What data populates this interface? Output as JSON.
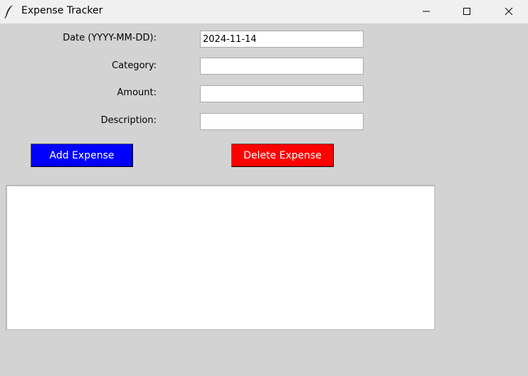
{
  "window": {
    "title": "Expense Tracker",
    "icons": {
      "app": "feather-icon",
      "minimize": "minimize-icon",
      "maximize": "maximize-icon",
      "close": "close-icon"
    }
  },
  "form": {
    "date_label": "Date (YYYY-MM-DD):",
    "date_value": "2024-11-14",
    "category_label": "Category:",
    "category_value": "",
    "amount_label": "Amount:",
    "amount_value": "",
    "description_label": "Description:",
    "description_value": ""
  },
  "buttons": {
    "add_label": "Add Expense",
    "add_color": "#0000ff",
    "delete_label": "Delete Expense",
    "delete_color": "#ff0000"
  },
  "expense_list": {
    "items": []
  }
}
